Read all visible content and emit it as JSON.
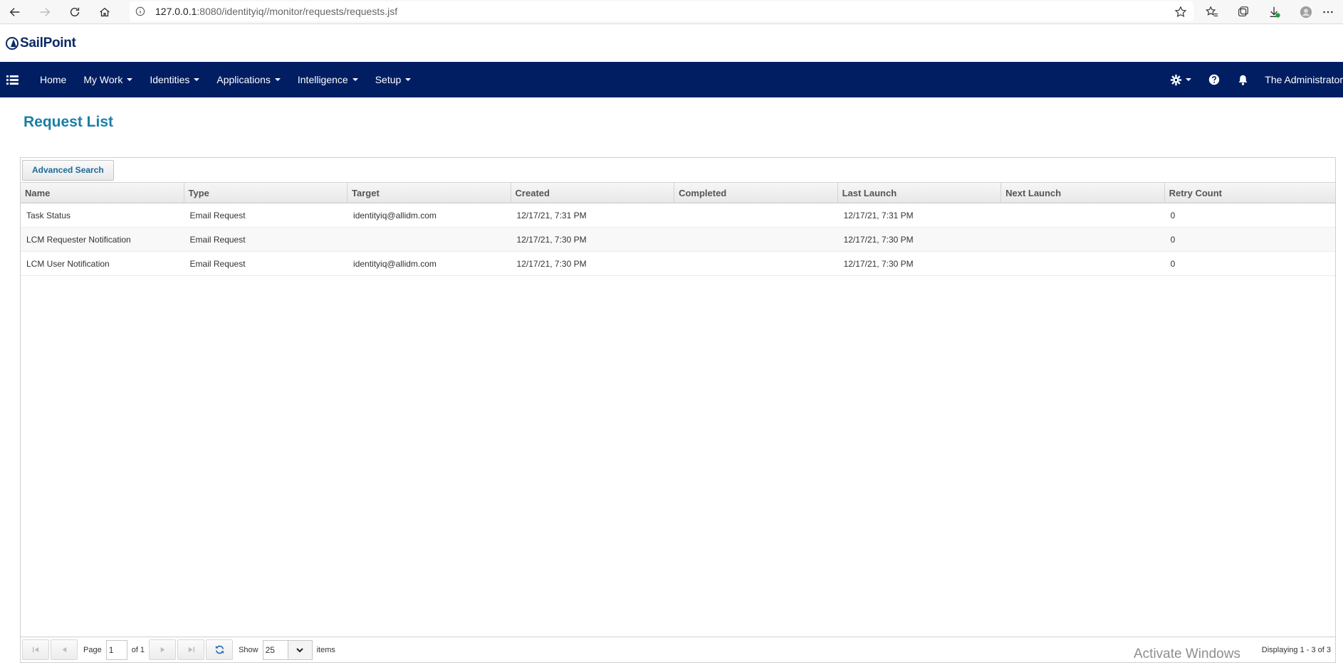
{
  "browser": {
    "url_host": "127.0.0.1",
    "url_rest": ":8080/identityiq//monitor/requests/requests.jsf"
  },
  "app": {
    "logo_text": "SailPoint"
  },
  "nav": {
    "items": [
      {
        "label": "Home",
        "has_caret": false
      },
      {
        "label": "My Work",
        "has_caret": true
      },
      {
        "label": "Identities",
        "has_caret": true
      },
      {
        "label": "Applications",
        "has_caret": true
      },
      {
        "label": "Intelligence",
        "has_caret": true
      },
      {
        "label": "Setup",
        "has_caret": true
      }
    ],
    "user_name": "The Administrator"
  },
  "page": {
    "title": "Request List"
  },
  "toolbar": {
    "advanced_search_label": "Advanced Search"
  },
  "table": {
    "columns": [
      "Name",
      "Type",
      "Target",
      "Created",
      "Completed",
      "Last Launch",
      "Next Launch",
      "Retry Count"
    ],
    "rows": [
      [
        "Task Status",
        "Email Request",
        "identityiq@allidm.com",
        "12/17/21, 7:31 PM",
        "",
        "12/17/21, 7:31 PM",
        "",
        "0"
      ],
      [
        "LCM Requester Notification",
        "Email Request",
        "",
        "12/17/21, 7:30 PM",
        "",
        "12/17/21, 7:30 PM",
        "",
        "0"
      ],
      [
        "LCM User Notification",
        "Email Request",
        "identityiq@allidm.com",
        "12/17/21, 7:30 PM",
        "",
        "12/17/21, 7:30 PM",
        "",
        "0"
      ]
    ]
  },
  "pager": {
    "page_label": "Page",
    "current_page": "1",
    "of_label": "of 1",
    "show_label": "Show",
    "page_size": "25",
    "items_label": "items",
    "display_text": "Displaying 1 - 3 of 3"
  },
  "watermark": {
    "text": "Activate Windows"
  }
}
